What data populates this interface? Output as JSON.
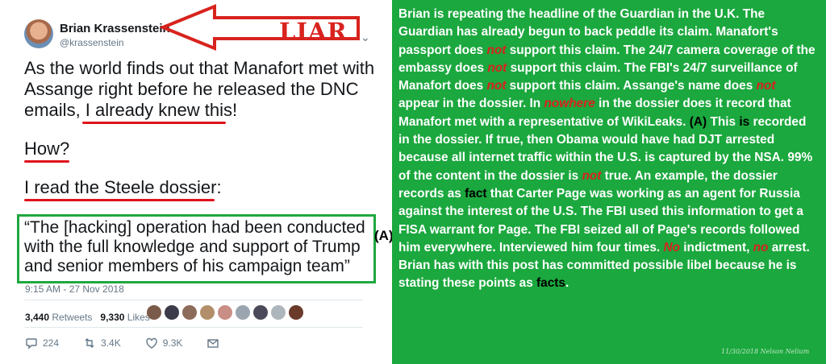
{
  "tweet": {
    "author_name": "Brian Krassenstein",
    "handle": "@krassenstein",
    "body_line1": "As the world finds out that Manafort met with",
    "body_line2": "Assange right before he released the DNC",
    "body_line3_a": "emails, ",
    "body_line3_b": "I already knew this!",
    "how": "How?",
    "read": "I read the Steele dossier:",
    "quote": "“The [hacking] operation had been conducted with the full knowledge and support of Trump and senior members of his campaign team”",
    "timestamp": "9:15 AM - 27 Nov 2018",
    "retweets_count": "3,440",
    "retweets_label": "Retweets",
    "likes_count": "9,330",
    "likes_label": "Likes",
    "reply_count": "224",
    "retweet_count": "3.4K",
    "like_count": "9.3K",
    "icons": [
      "chevron-down-icon",
      "reply-icon",
      "retweet-icon",
      "heart-icon",
      "envelope-icon"
    ]
  },
  "annotation": {
    "liar_label": "LIAR",
    "marker": "(A)",
    "arrow_color": "#d8231e",
    "box_color": "#1fa83f",
    "underline_color": "#e0121a"
  },
  "commentary": {
    "background": "#1ba83e",
    "s1": "Brian is repeating the headline of the Guardian in the U.K. The Guardian has already begun to back peddle its claim. Manafort's passport does ",
    "not1": "not",
    "s2": " support this claim. The 24/7 camera coverage of the embassy does ",
    "not2": "not",
    "s3": " support this claim. The FBI's 24/7 surveillance of Manafort does ",
    "not3": "not",
    "s4": " support this claim. Assange's name does ",
    "not4": "not",
    "s5": " appear in the dossier. In ",
    "nowhere": "nowhere",
    "s6": " in the dossier does it record that Manafort met with a representative of WikiLeaks. ",
    "marker": "(A)",
    "s7": " This ",
    "is": "is",
    "s8": " recorded in the dossier. If true, then Obama would have had DJT arrested because all internet traffic within the U.S. is captured by the NSA. 99% of the content in the dossier is ",
    "not5": "not",
    "s9": " true. An example, the dossier records as ",
    "fact": "fact",
    "s10": " that Carter Page was working as an agent for Russia against the interest of the U.S. The FBI used this information to get a FISA warrant for Page. The FBI seized all of Page's records followed him everywhere. Interviewed him four times. ",
    "no1": "No",
    "s11": " indictment, ",
    "no2": "no",
    "s12": " arrest. Brian has with this post has committed possible libel because he is stating these points as ",
    "facts": "facts",
    "s13": ".",
    "signature": "11/30/2018 Nelson Nelium"
  }
}
